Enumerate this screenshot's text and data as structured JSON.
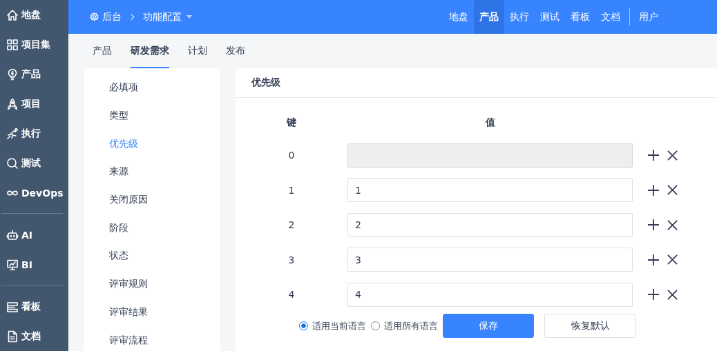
{
  "sidebar": {
    "groups": [
      [
        {
          "label": "地盘"
        },
        {
          "label": "项目集"
        },
        {
          "label": "产品"
        },
        {
          "label": "项目"
        },
        {
          "label": "执行"
        },
        {
          "label": "测试"
        },
        {
          "label": "DevOps"
        }
      ],
      [
        {
          "label": "AI"
        },
        {
          "label": "BI"
        }
      ],
      [
        {
          "label": "看板"
        },
        {
          "label": "文档"
        }
      ]
    ]
  },
  "topbar": {
    "breadcrumb": {
      "home": "后台",
      "current": "功能配置"
    },
    "nav": [
      {
        "label": "地盘",
        "selected": false
      },
      {
        "label": "产品",
        "selected": true
      },
      {
        "label": "执行",
        "selected": false
      },
      {
        "label": "测试",
        "selected": false
      },
      {
        "label": "看板",
        "selected": false
      },
      {
        "label": "文档",
        "selected": false
      }
    ],
    "user": "用户"
  },
  "tabs": [
    {
      "label": "产品",
      "selected": false
    },
    {
      "label": "研发需求",
      "selected": true
    },
    {
      "label": "计划",
      "selected": false
    },
    {
      "label": "发布",
      "selected": false
    }
  ],
  "menu": [
    {
      "label": "必填项",
      "selected": false
    },
    {
      "label": "类型",
      "selected": false
    },
    {
      "label": "优先级",
      "selected": true
    },
    {
      "label": "来源",
      "selected": false
    },
    {
      "label": "关闭原因",
      "selected": false
    },
    {
      "label": "阶段",
      "selected": false
    },
    {
      "label": "状态",
      "selected": false
    },
    {
      "label": "评审规则",
      "selected": false
    },
    {
      "label": "评审结果",
      "selected": false
    },
    {
      "label": "评审流程",
      "selected": false
    }
  ],
  "panel": {
    "title": "优先级",
    "key_header": "键",
    "value_header": "值",
    "rows": [
      {
        "key": "0",
        "value": "",
        "disabled": true
      },
      {
        "key": "1",
        "value": "1",
        "disabled": false
      },
      {
        "key": "2",
        "value": "2",
        "disabled": false
      },
      {
        "key": "3",
        "value": "3",
        "disabled": false
      },
      {
        "key": "4",
        "value": "4",
        "disabled": false
      }
    ],
    "scope": [
      {
        "label": "适用当前语言",
        "selected": true
      },
      {
        "label": "适用所有语言",
        "selected": false
      }
    ],
    "buttons": [
      {
        "label": "保存",
        "kind": "primary"
      },
      {
        "label": "恢复默认",
        "kind": "default"
      }
    ]
  }
}
